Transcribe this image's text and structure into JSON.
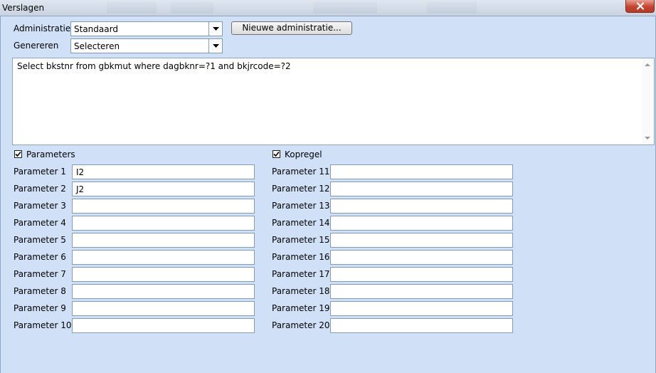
{
  "window": {
    "title": "Verslagen"
  },
  "form": {
    "administratie_label": "Administratie",
    "administratie_value": "Standaard",
    "nieuwe_button": "Nieuwe administratie...",
    "genereren_label": "Genereren",
    "genereren_value": "Selecteren",
    "sql": "Select bkstnr from gbkmut where dagbknr=?1 and bkjrcode=?2",
    "parameters_checkbox": "Parameters",
    "parameters_checked": true,
    "kopregel_checkbox": "Kopregel",
    "kopregel_checked": true
  },
  "params_left": [
    {
      "label": "Parameter 1",
      "value": "I2"
    },
    {
      "label": "Parameter 2",
      "value": "J2"
    },
    {
      "label": "Parameter 3",
      "value": ""
    },
    {
      "label": "Parameter 4",
      "value": ""
    },
    {
      "label": "Parameter 5",
      "value": ""
    },
    {
      "label": "Parameter 6",
      "value": ""
    },
    {
      "label": "Parameter 7",
      "value": ""
    },
    {
      "label": "Parameter 8",
      "value": ""
    },
    {
      "label": "Parameter 9",
      "value": ""
    },
    {
      "label": "Parameter 10",
      "value": ""
    }
  ],
  "params_right": [
    {
      "label": "Parameter 11",
      "value": ""
    },
    {
      "label": "Parameter 12",
      "value": ""
    },
    {
      "label": "Parameter 13",
      "value": ""
    },
    {
      "label": "Parameter 14",
      "value": ""
    },
    {
      "label": "Parameter 15",
      "value": ""
    },
    {
      "label": "Parameter 16",
      "value": ""
    },
    {
      "label": "Parameter 17",
      "value": ""
    },
    {
      "label": "Parameter 18",
      "value": ""
    },
    {
      "label": "Parameter 19",
      "value": ""
    },
    {
      "label": "Parameter 20",
      "value": ""
    }
  ],
  "icons": {
    "close": "close-icon",
    "dropdown": "chevron-down-icon",
    "check": "check-icon"
  },
  "colors": {
    "background": "#cfe0f7",
    "close_button": "#c7442f"
  }
}
